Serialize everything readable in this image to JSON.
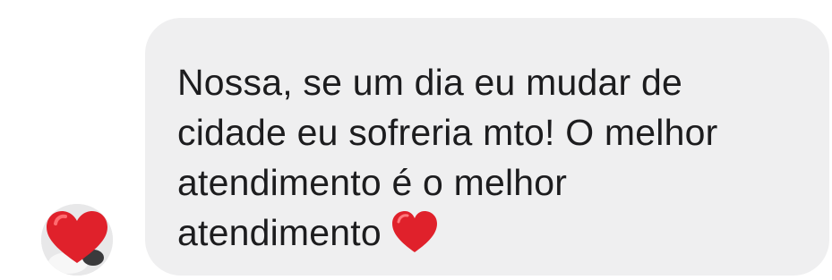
{
  "message": {
    "lines": [
      "Nossa, se um dia eu mudar de",
      "cidade eu sofreria mto! O melhor",
      "atendimento é o melhor",
      "atendimento"
    ],
    "trailing_emoji": "red-heart-icon"
  },
  "avatar": {
    "icon": "red-heart-icon"
  },
  "colors": {
    "bubble": "#efeff0",
    "text": "#1c1c1e",
    "heart": "#e0212b"
  }
}
